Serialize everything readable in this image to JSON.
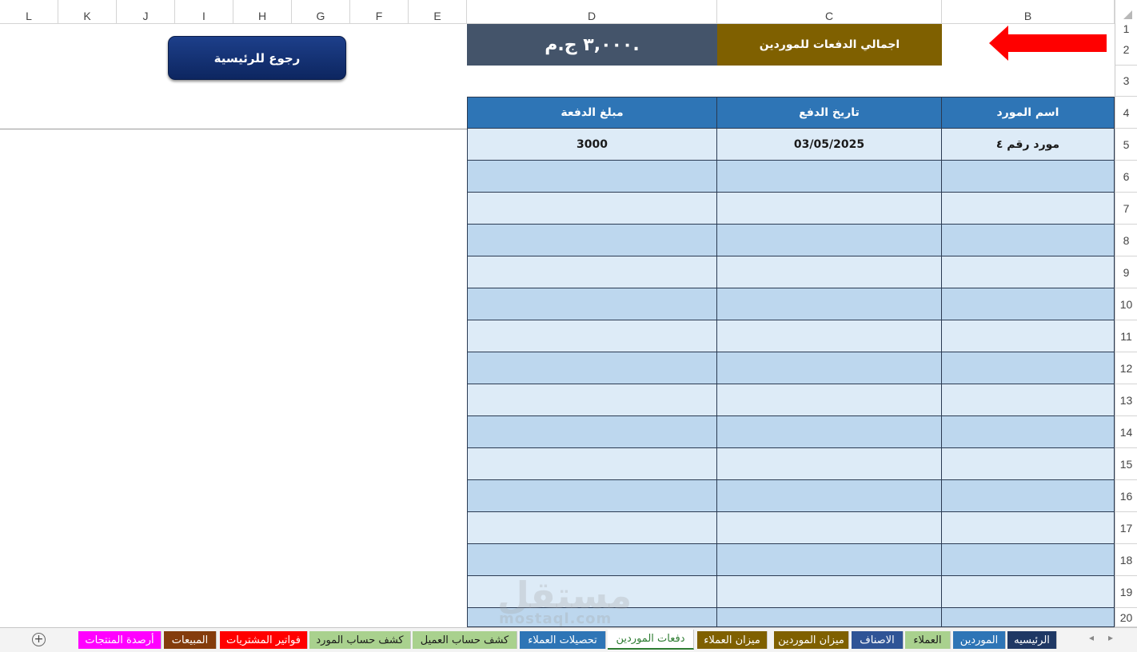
{
  "columns": [
    "L",
    "K",
    "J",
    "I",
    "H",
    "G",
    "F",
    "E",
    "D",
    "C",
    "B"
  ],
  "rows": [
    "1",
    "2",
    "3",
    "4",
    "5",
    "6",
    "7",
    "8",
    "9",
    "10",
    "11",
    "12",
    "13",
    "14",
    "15",
    "16",
    "17",
    "18",
    "19",
    "20"
  ],
  "summary": {
    "label": "اجمالي الدفعات للموردين",
    "value": "٣,٠٠٠ ج.م."
  },
  "back_button": {
    "label": "رجوع للرئيسية"
  },
  "table": {
    "headers": [
      "اسم المورد",
      "تاريخ الدفع",
      "مبلغ الدفعة"
    ],
    "rows": [
      [
        "مورد رقم ٤",
        "03/05/2025",
        "3000"
      ]
    ]
  },
  "colors": {
    "header_blue": "#2e75b6",
    "row_dark": "#bdd7ee",
    "row_light": "#ddebf7",
    "total_label_bg": "#7f6000",
    "total_value_bg": "#44546a",
    "button_bg": "#0d2660",
    "arrow_red": "#ff0000"
  },
  "sheet_tabs": [
    {
      "label": "الرئيسيه",
      "bg": "#1f3864",
      "fg": "#ffffff",
      "active": false
    },
    {
      "label": "الموردين",
      "bg": "#2e75b6",
      "fg": "#ffffff",
      "active": false
    },
    {
      "label": "العملاء",
      "bg": "#a9d18e",
      "fg": "#1a1a1a",
      "active": false
    },
    {
      "label": "الاصناف",
      "bg": "#2f5496",
      "fg": "#ffffff",
      "active": false
    },
    {
      "label": "ميزان الموردين",
      "bg": "#7f6000",
      "fg": "#ffffff",
      "active": false
    },
    {
      "label": "ميزان العملاء",
      "bg": "#7f6000",
      "fg": "#ffffff",
      "active": false
    },
    {
      "label": "دفعات الموردين",
      "bg": "#ffffff",
      "fg": "#2e7d32",
      "active": true
    },
    {
      "label": "تحصيلات العملاء",
      "bg": "#2e75b6",
      "fg": "#ffffff",
      "active": false
    },
    {
      "label": "كشف حساب العميل",
      "bg": "#a9d18e",
      "fg": "#1a1a1a",
      "active": false
    },
    {
      "label": "كشف حساب المورد",
      "bg": "#a9d18e",
      "fg": "#1a1a1a",
      "active": false
    },
    {
      "label": "فواتير المشتريات",
      "bg": "#ff0000",
      "fg": "#ffffff",
      "active": false
    },
    {
      "label": "المبيعات",
      "bg": "#843c0c",
      "fg": "#ffffff",
      "active": false
    },
    {
      "label": "أرصدة المنتجات",
      "bg": "#ff00ff",
      "fg": "#ffffff",
      "active": false
    }
  ],
  "watermark": {
    "main": "مستقل",
    "sub": "mostaql.com"
  },
  "icons": {
    "add_sheet": "plus-circle-icon",
    "scroll_prev": "chevron-left-icon",
    "scroll_next": "chevron-right-icon",
    "arrow": "red-arrow-left-icon"
  }
}
